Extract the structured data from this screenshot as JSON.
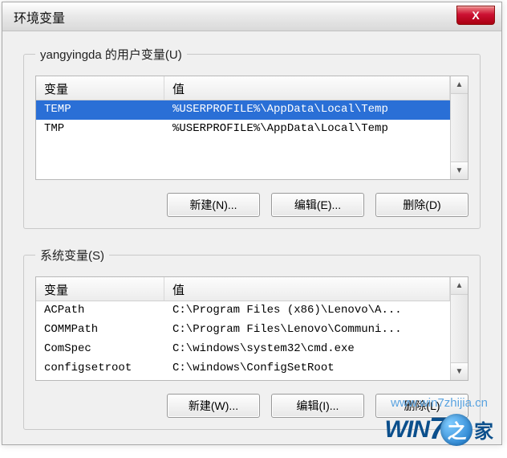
{
  "window": {
    "title": "环境变量",
    "close_label": "X"
  },
  "user_group": {
    "legend": "yangyingda 的用户变量(U)",
    "columns": {
      "var": "变量",
      "val": "值"
    },
    "rows": [
      {
        "var": "TEMP",
        "val": "%USERPROFILE%\\AppData\\Local\\Temp",
        "selected": true
      },
      {
        "var": "TMP",
        "val": "%USERPROFILE%\\AppData\\Local\\Temp",
        "selected": false
      }
    ],
    "buttons": {
      "new": "新建(N)...",
      "edit": "编辑(E)...",
      "delete": "删除(D)"
    }
  },
  "system_group": {
    "legend": "系统变量(S)",
    "columns": {
      "var": "变量",
      "val": "值"
    },
    "rows": [
      {
        "var": "ACPath",
        "val": "C:\\Program Files (x86)\\Lenovo\\A..."
      },
      {
        "var": "COMMPath",
        "val": "C:\\Program Files\\Lenovo\\Communi..."
      },
      {
        "var": "ComSpec",
        "val": "C:\\windows\\system32\\cmd.exe"
      },
      {
        "var": "configsetroot",
        "val": "C:\\windows\\ConfigSetRoot"
      }
    ],
    "buttons": {
      "new": "新建(W)...",
      "edit": "编辑(I)...",
      "delete": "删除(L)"
    }
  },
  "watermark": {
    "url": "www.win7zhijia.cn"
  },
  "logo": {
    "text_w": "W",
    "text_i": "I",
    "text_n": "N",
    "text_7": "7",
    "cn_char": "家",
    "orb_char": "之"
  }
}
